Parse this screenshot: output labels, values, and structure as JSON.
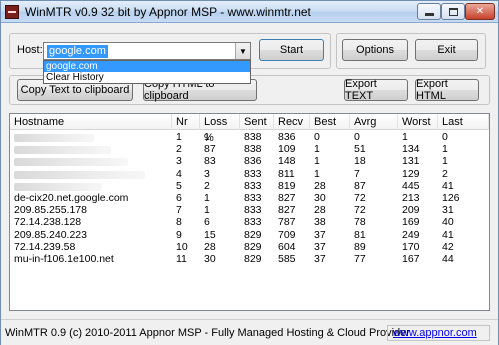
{
  "window": {
    "title": "WinMTR v0.9 32 bit by Appnor MSP - www.winmtr.net"
  },
  "host": {
    "label": "Host:",
    "value": "google.com",
    "dropdown_items": [
      "google.com",
      "Clear History"
    ]
  },
  "buttons": {
    "start": "Start",
    "options": "Options",
    "exit": "Exit",
    "copy_text": "Copy Text to clipboard",
    "copy_html": "Copy HTML to clipboard",
    "export_text": "Export TEXT",
    "export_html": "Export HTML"
  },
  "table": {
    "columns": [
      "Hostname",
      "Nr",
      "Loss %",
      "Sent",
      "Recv",
      "Best",
      "Avrg",
      "Worst",
      "Last"
    ],
    "rows": [
      [
        "",
        "1",
        "1",
        "838",
        "836",
        "0",
        "0",
        "1",
        "0"
      ],
      [
        "",
        "2",
        "87",
        "838",
        "109",
        "1",
        "51",
        "134",
        "1"
      ],
      [
        "",
        "3",
        "83",
        "836",
        "148",
        "1",
        "18",
        "131",
        "1"
      ],
      [
        "",
        "4",
        "3",
        "833",
        "811",
        "1",
        "7",
        "129",
        "2"
      ],
      [
        "",
        "5",
        "2",
        "833",
        "819",
        "28",
        "87",
        "445",
        "41"
      ],
      [
        "de-cix20.net.google.com",
        "6",
        "1",
        "833",
        "827",
        "30",
        "72",
        "213",
        "126"
      ],
      [
        "209.85.255.178",
        "7",
        "1",
        "833",
        "827",
        "28",
        "72",
        "209",
        "31"
      ],
      [
        "72.14.238.128",
        "8",
        "6",
        "833",
        "787",
        "38",
        "78",
        "169",
        "40"
      ],
      [
        "209.85.240.223",
        "9",
        "15",
        "829",
        "709",
        "37",
        "81",
        "249",
        "41"
      ],
      [
        "72.14.239.58",
        "10",
        "28",
        "829",
        "604",
        "37",
        "89",
        "170",
        "42"
      ],
      [
        "mu-in-f106.1e100.net",
        "11",
        "30",
        "829",
        "585",
        "37",
        "77",
        "167",
        "44"
      ]
    ]
  },
  "status": {
    "text": "WinMTR 0.9 (c) 2010-2011 Appnor MSP - Fully Managed Hosting & Cloud Provider",
    "link": "www.appnor.com"
  },
  "icons": {
    "app": "winmtr-app-icon",
    "minimize": "minimize-icon",
    "maximize": "maximize-icon",
    "close": "close-icon",
    "dropdown": "chevron-down-icon"
  }
}
